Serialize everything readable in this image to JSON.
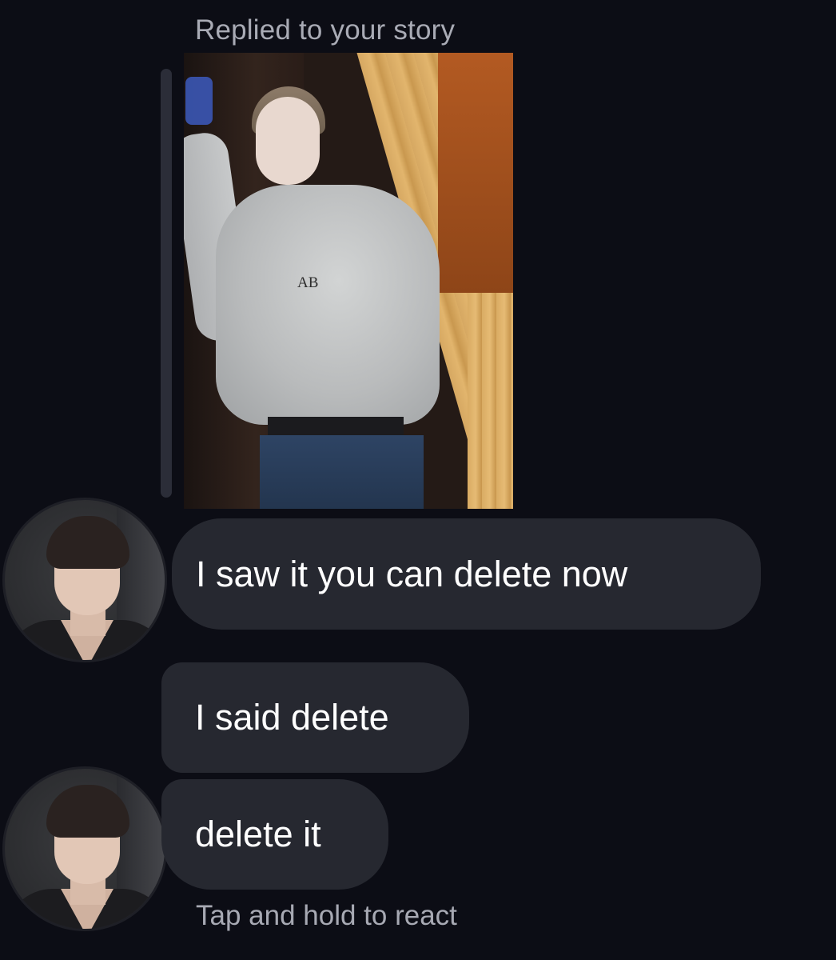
{
  "reply": {
    "caption": "Replied to your story",
    "story_image": "story-photo",
    "story_text": "AB"
  },
  "messages": [
    {
      "text": "I saw it you can delete now"
    },
    {
      "text": "I said delete"
    },
    {
      "text": "delete it"
    }
  ],
  "footer": {
    "hint": "Tap and hold to react"
  },
  "colors": {
    "background": "#0c0d15",
    "bubble": "#262830",
    "message_text": "#ffffff",
    "muted_text": "#a9abb5"
  }
}
